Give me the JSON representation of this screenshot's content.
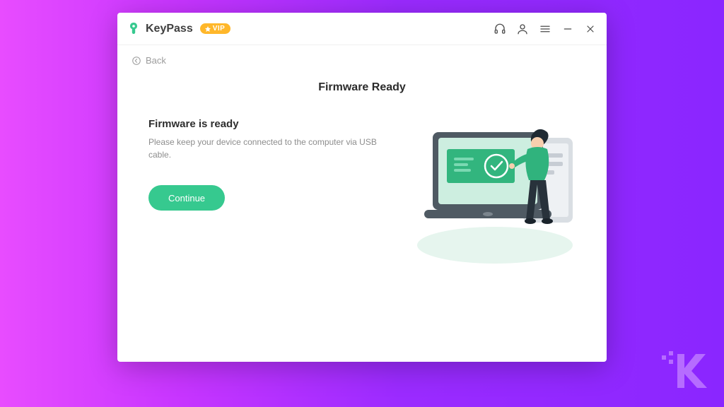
{
  "app": {
    "name": "KeyPass",
    "vip_label": "VIP"
  },
  "nav": {
    "back_label": "Back"
  },
  "page": {
    "title": "Firmware Ready",
    "subhead": "Firmware is ready",
    "description": "Please keep your device connected to the computer via USB cable.",
    "continue_label": "Continue"
  },
  "colors": {
    "accent": "#36c98f",
    "vip_bg": "#ffb72a"
  }
}
